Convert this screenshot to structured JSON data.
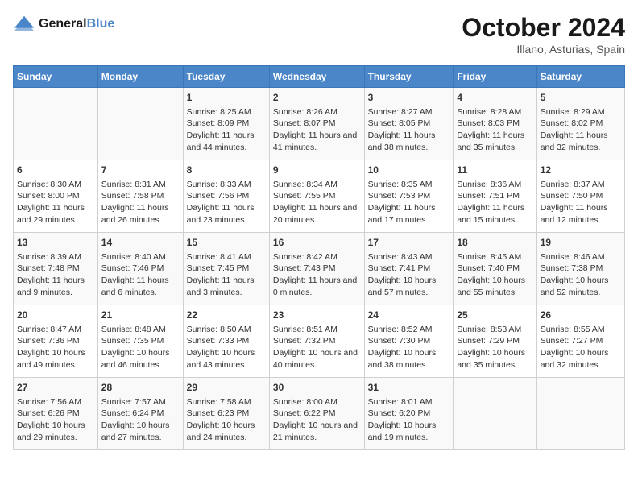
{
  "logo": {
    "line1": "General",
    "line2": "Blue"
  },
  "title": "October 2024",
  "location": "Illano, Asturias, Spain",
  "weekdays": [
    "Sunday",
    "Monday",
    "Tuesday",
    "Wednesday",
    "Thursday",
    "Friday",
    "Saturday"
  ],
  "weeks": [
    [
      {
        "day": "",
        "sunrise": "",
        "sunset": "",
        "daylight": ""
      },
      {
        "day": "",
        "sunrise": "",
        "sunset": "",
        "daylight": ""
      },
      {
        "day": "1",
        "sunrise": "Sunrise: 8:25 AM",
        "sunset": "Sunset: 8:09 PM",
        "daylight": "Daylight: 11 hours and 44 minutes."
      },
      {
        "day": "2",
        "sunrise": "Sunrise: 8:26 AM",
        "sunset": "Sunset: 8:07 PM",
        "daylight": "Daylight: 11 hours and 41 minutes."
      },
      {
        "day": "3",
        "sunrise": "Sunrise: 8:27 AM",
        "sunset": "Sunset: 8:05 PM",
        "daylight": "Daylight: 11 hours and 38 minutes."
      },
      {
        "day": "4",
        "sunrise": "Sunrise: 8:28 AM",
        "sunset": "Sunset: 8:03 PM",
        "daylight": "Daylight: 11 hours and 35 minutes."
      },
      {
        "day": "5",
        "sunrise": "Sunrise: 8:29 AM",
        "sunset": "Sunset: 8:02 PM",
        "daylight": "Daylight: 11 hours and 32 minutes."
      }
    ],
    [
      {
        "day": "6",
        "sunrise": "Sunrise: 8:30 AM",
        "sunset": "Sunset: 8:00 PM",
        "daylight": "Daylight: 11 hours and 29 minutes."
      },
      {
        "day": "7",
        "sunrise": "Sunrise: 8:31 AM",
        "sunset": "Sunset: 7:58 PM",
        "daylight": "Daylight: 11 hours and 26 minutes."
      },
      {
        "day": "8",
        "sunrise": "Sunrise: 8:33 AM",
        "sunset": "Sunset: 7:56 PM",
        "daylight": "Daylight: 11 hours and 23 minutes."
      },
      {
        "day": "9",
        "sunrise": "Sunrise: 8:34 AM",
        "sunset": "Sunset: 7:55 PM",
        "daylight": "Daylight: 11 hours and 20 minutes."
      },
      {
        "day": "10",
        "sunrise": "Sunrise: 8:35 AM",
        "sunset": "Sunset: 7:53 PM",
        "daylight": "Daylight: 11 hours and 17 minutes."
      },
      {
        "day": "11",
        "sunrise": "Sunrise: 8:36 AM",
        "sunset": "Sunset: 7:51 PM",
        "daylight": "Daylight: 11 hours and 15 minutes."
      },
      {
        "day": "12",
        "sunrise": "Sunrise: 8:37 AM",
        "sunset": "Sunset: 7:50 PM",
        "daylight": "Daylight: 11 hours and 12 minutes."
      }
    ],
    [
      {
        "day": "13",
        "sunrise": "Sunrise: 8:39 AM",
        "sunset": "Sunset: 7:48 PM",
        "daylight": "Daylight: 11 hours and 9 minutes."
      },
      {
        "day": "14",
        "sunrise": "Sunrise: 8:40 AM",
        "sunset": "Sunset: 7:46 PM",
        "daylight": "Daylight: 11 hours and 6 minutes."
      },
      {
        "day": "15",
        "sunrise": "Sunrise: 8:41 AM",
        "sunset": "Sunset: 7:45 PM",
        "daylight": "Daylight: 11 hours and 3 minutes."
      },
      {
        "day": "16",
        "sunrise": "Sunrise: 8:42 AM",
        "sunset": "Sunset: 7:43 PM",
        "daylight": "Daylight: 11 hours and 0 minutes."
      },
      {
        "day": "17",
        "sunrise": "Sunrise: 8:43 AM",
        "sunset": "Sunset: 7:41 PM",
        "daylight": "Daylight: 10 hours and 57 minutes."
      },
      {
        "day": "18",
        "sunrise": "Sunrise: 8:45 AM",
        "sunset": "Sunset: 7:40 PM",
        "daylight": "Daylight: 10 hours and 55 minutes."
      },
      {
        "day": "19",
        "sunrise": "Sunrise: 8:46 AM",
        "sunset": "Sunset: 7:38 PM",
        "daylight": "Daylight: 10 hours and 52 minutes."
      }
    ],
    [
      {
        "day": "20",
        "sunrise": "Sunrise: 8:47 AM",
        "sunset": "Sunset: 7:36 PM",
        "daylight": "Daylight: 10 hours and 49 minutes."
      },
      {
        "day": "21",
        "sunrise": "Sunrise: 8:48 AM",
        "sunset": "Sunset: 7:35 PM",
        "daylight": "Daylight: 10 hours and 46 minutes."
      },
      {
        "day": "22",
        "sunrise": "Sunrise: 8:50 AM",
        "sunset": "Sunset: 7:33 PM",
        "daylight": "Daylight: 10 hours and 43 minutes."
      },
      {
        "day": "23",
        "sunrise": "Sunrise: 8:51 AM",
        "sunset": "Sunset: 7:32 PM",
        "daylight": "Daylight: 10 hours and 40 minutes."
      },
      {
        "day": "24",
        "sunrise": "Sunrise: 8:52 AM",
        "sunset": "Sunset: 7:30 PM",
        "daylight": "Daylight: 10 hours and 38 minutes."
      },
      {
        "day": "25",
        "sunrise": "Sunrise: 8:53 AM",
        "sunset": "Sunset: 7:29 PM",
        "daylight": "Daylight: 10 hours and 35 minutes."
      },
      {
        "day": "26",
        "sunrise": "Sunrise: 8:55 AM",
        "sunset": "Sunset: 7:27 PM",
        "daylight": "Daylight: 10 hours and 32 minutes."
      }
    ],
    [
      {
        "day": "27",
        "sunrise": "Sunrise: 7:56 AM",
        "sunset": "Sunset: 6:26 PM",
        "daylight": "Daylight: 10 hours and 29 minutes."
      },
      {
        "day": "28",
        "sunrise": "Sunrise: 7:57 AM",
        "sunset": "Sunset: 6:24 PM",
        "daylight": "Daylight: 10 hours and 27 minutes."
      },
      {
        "day": "29",
        "sunrise": "Sunrise: 7:58 AM",
        "sunset": "Sunset: 6:23 PM",
        "daylight": "Daylight: 10 hours and 24 minutes."
      },
      {
        "day": "30",
        "sunrise": "Sunrise: 8:00 AM",
        "sunset": "Sunset: 6:22 PM",
        "daylight": "Daylight: 10 hours and 21 minutes."
      },
      {
        "day": "31",
        "sunrise": "Sunrise: 8:01 AM",
        "sunset": "Sunset: 6:20 PM",
        "daylight": "Daylight: 10 hours and 19 minutes."
      },
      {
        "day": "",
        "sunrise": "",
        "sunset": "",
        "daylight": ""
      },
      {
        "day": "",
        "sunrise": "",
        "sunset": "",
        "daylight": ""
      }
    ]
  ]
}
